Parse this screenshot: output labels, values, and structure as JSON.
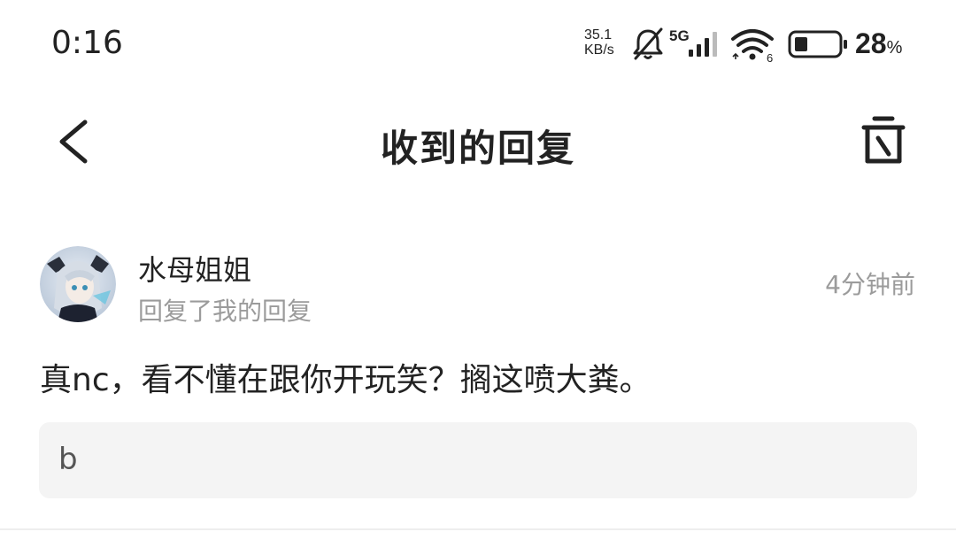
{
  "status_bar": {
    "time": "0:16",
    "net_speed_value": "35.1",
    "net_speed_unit": "KB/s",
    "network_type": "5G",
    "wifi_label": "6",
    "battery_percent": "28",
    "battery_unit": "%",
    "icons": [
      "bell-off-icon",
      "signal-icon",
      "wifi-icon",
      "battery-icon"
    ]
  },
  "nav": {
    "title": "收到的回复",
    "back_icon": "chevron-left-icon",
    "right_icon": "clear-icon"
  },
  "reply": {
    "username": "水母姐姐",
    "reply_type": "回复了我的回复",
    "time": "4分钟前",
    "content": "真nc，看不懂在跟你开玩笑？搁这喷大粪。",
    "quoted": "b"
  },
  "colors": {
    "text_primary": "#222222",
    "text_secondary": "#9b9b9b",
    "quote_bg": "#f4f4f4",
    "divider": "#eeeeee"
  }
}
